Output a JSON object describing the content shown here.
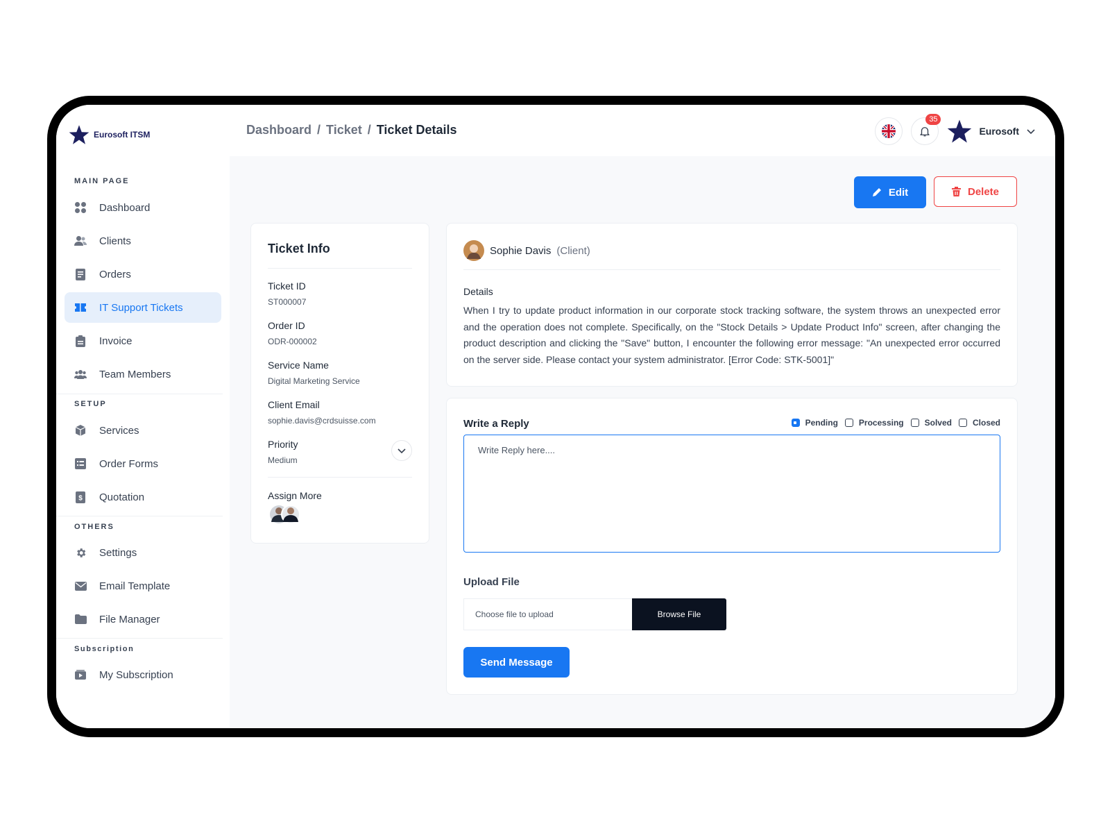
{
  "brand": {
    "name": "Eurosoft ITSM"
  },
  "sidebar": {
    "sections": {
      "main": "MAIN PAGE",
      "setup": "SETUP",
      "others": "OTHERS",
      "subscription": "Subscription"
    },
    "items": [
      {
        "label": "Dashboard",
        "icon": "grid-icon"
      },
      {
        "label": "Clients",
        "icon": "users-icon"
      },
      {
        "label": "Orders",
        "icon": "document-icon"
      },
      {
        "label": "IT Support Tickets",
        "icon": "ticket-icon",
        "active": true
      },
      {
        "label": "Invoice",
        "icon": "clipboard-icon"
      },
      {
        "label": "Team Members",
        "icon": "team-icon"
      },
      {
        "label": "Services",
        "icon": "box-icon"
      },
      {
        "label": "Order Forms",
        "icon": "form-icon"
      },
      {
        "label": "Quotation",
        "icon": "quotation-icon"
      },
      {
        "label": "Settings",
        "icon": "gear-icon"
      },
      {
        "label": "Email Template",
        "icon": "email-icon"
      },
      {
        "label": "File Manager",
        "icon": "folder-icon"
      },
      {
        "label": "My Subscription",
        "icon": "play-icon"
      }
    ]
  },
  "header": {
    "breadcrumb": [
      "Dashboard",
      "Ticket",
      "Ticket Details"
    ],
    "separator": "/",
    "notifications_count": "35",
    "user_name": "Eurosoft"
  },
  "actions": {
    "edit": "Edit",
    "delete": "Delete"
  },
  "ticket_info": {
    "title": "Ticket Info",
    "fields": [
      {
        "label": "Ticket ID",
        "value": "ST000007"
      },
      {
        "label": "Order ID",
        "value": "ODR-000002"
      },
      {
        "label": "Service Name",
        "value": "Digital Marketing Service"
      },
      {
        "label": "Client Email",
        "value": "sophie.davis@crdsuisse.com"
      },
      {
        "label": "Priority",
        "value": "Medium"
      }
    ],
    "assign_label": "Assign More"
  },
  "ticket_detail": {
    "client_name": "Sophie Davis",
    "client_role": "(Client)",
    "details_label": "Details",
    "details_text": "When I try to update product information in our corporate stock tracking software, the system throws an unexpected error and the operation does not complete. Specifically, on the \"Stock Details > Update Product Info\" screen, after changing the product description and clicking the \"Save\" button, I encounter the following error message: \"An unexpected error occurred on the server side. Please contact your system administrator. [Error Code: STK-5001]\""
  },
  "reply": {
    "title": "Write a Reply",
    "statuses": [
      {
        "label": "Pending",
        "checked": true
      },
      {
        "label": "Processing",
        "checked": false
      },
      {
        "label": "Solved",
        "checked": false
      },
      {
        "label": "Closed",
        "checked": false
      }
    ],
    "placeholder": "Write Reply here....",
    "upload_label": "Upload File",
    "upload_placeholder": "Choose file to upload",
    "browse_label": "Browse File",
    "send_label": "Send Message"
  },
  "colors": {
    "primary": "#1877f2",
    "danger": "#ef4444",
    "brand_star": "#1c1f5e",
    "active_bg": "#e6effb"
  }
}
